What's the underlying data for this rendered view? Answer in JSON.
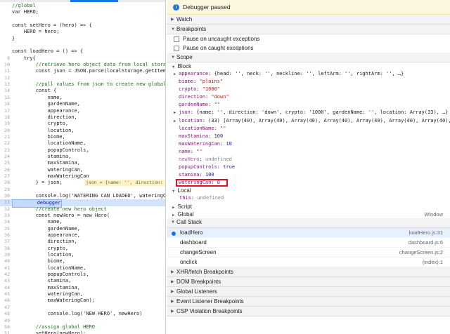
{
  "editor": {
    "lines": [
      {
        "n": "",
        "t": "//global",
        "kind": "comment"
      },
      {
        "n": "",
        "t": "var HERO;",
        "kind": "code"
      },
      {
        "n": "",
        "t": "",
        "kind": "code"
      },
      {
        "n": "",
        "t": "const setHero = (hero) => {",
        "kind": "code"
      },
      {
        "n": "",
        "t": "    HERO = hero;",
        "kind": "code"
      },
      {
        "n": "",
        "t": "}",
        "kind": "code"
      },
      {
        "n": "",
        "t": "",
        "kind": "code"
      },
      {
        "n": "",
        "t": "const loadHero = () => {",
        "kind": "code"
      },
      {
        "n": "9",
        "t": "    try{",
        "kind": "code"
      },
      {
        "n": "10",
        "t": "        //retrieve hero object data from local stora",
        "kind": "comment"
      },
      {
        "n": "11",
        "t": "        const json = JSON.parse(localStorage.getItem",
        "kind": "code"
      },
      {
        "n": "12",
        "t": "",
        "kind": "code"
      },
      {
        "n": "13",
        "t": "        //pull values from json to create new global",
        "kind": "comment"
      },
      {
        "n": "14",
        "t": "        const {",
        "kind": "code"
      },
      {
        "n": "15",
        "t": "            name,",
        "kind": "code"
      },
      {
        "n": "16",
        "t": "            gardenName,",
        "kind": "code"
      },
      {
        "n": "17",
        "t": "            appearance,",
        "kind": "code"
      },
      {
        "n": "18",
        "t": "            direction,",
        "kind": "code"
      },
      {
        "n": "19",
        "t": "            crypto,",
        "kind": "code"
      },
      {
        "n": "20",
        "t": "            location,",
        "kind": "code"
      },
      {
        "n": "21",
        "t": "            biome,",
        "kind": "code"
      },
      {
        "n": "22",
        "t": "            locationName,",
        "kind": "code"
      },
      {
        "n": "23",
        "t": "            popupControls,",
        "kind": "code"
      },
      {
        "n": "24",
        "t": "            stamina,",
        "kind": "code"
      },
      {
        "n": "25",
        "t": "            maxStamina,",
        "kind": "code"
      },
      {
        "n": "26",
        "t": "            wateringCan,",
        "kind": "code"
      },
      {
        "n": "27",
        "t": "            maxWateringCan",
        "kind": "code"
      },
      {
        "n": "28",
        "t": "        } = json;",
        "kind": "code",
        "inline": "json = {name: '', direction: 'dow"
      },
      {
        "n": "29",
        "t": "",
        "kind": "code"
      },
      {
        "n": "30",
        "t": "        console.log('WATERING CAN LOADED', wateringC",
        "kind": "code"
      },
      {
        "n": "31",
        "t": "        debugger",
        "kind": "exec"
      },
      {
        "n": "32",
        "t": "        //create new hero object",
        "kind": "comment"
      },
      {
        "n": "33",
        "t": "        const newHero = new Hero(",
        "kind": "code"
      },
      {
        "n": "34",
        "t": "            name,",
        "kind": "code"
      },
      {
        "n": "35",
        "t": "            gardenName,",
        "kind": "code"
      },
      {
        "n": "36",
        "t": "            appearance,",
        "kind": "code"
      },
      {
        "n": "37",
        "t": "            direction,",
        "kind": "code"
      },
      {
        "n": "38",
        "t": "            crypto,",
        "kind": "code"
      },
      {
        "n": "39",
        "t": "            location,",
        "kind": "code"
      },
      {
        "n": "40",
        "t": "            biome,",
        "kind": "code"
      },
      {
        "n": "41",
        "t": "            locationName,",
        "kind": "code"
      },
      {
        "n": "42",
        "t": "            popupControls,",
        "kind": "code"
      },
      {
        "n": "43",
        "t": "            stamina,",
        "kind": "code"
      },
      {
        "n": "44",
        "t": "            maxStamina,",
        "kind": "code"
      },
      {
        "n": "45",
        "t": "            wateringCan,",
        "kind": "code"
      },
      {
        "n": "46",
        "t": "            maxWateringCan);",
        "kind": "code"
      },
      {
        "n": "47",
        "t": "",
        "kind": "code"
      },
      {
        "n": "48",
        "t": "            console.log('NEW HERO', newHero)",
        "kind": "code"
      },
      {
        "n": "49",
        "t": "",
        "kind": "code"
      },
      {
        "n": "50",
        "t": "        //assign global HERO",
        "kind": "comment"
      },
      {
        "n": "51",
        "t": "        setHero(newHero);",
        "kind": "code"
      },
      {
        "n": "52",
        "t": "        console.log('Hero Loaded:', newHero)",
        "kind": "code"
      }
    ]
  },
  "debugger": {
    "banner": "Debugger paused",
    "sections": {
      "watch": "Watch",
      "breakpoints": "Breakpoints",
      "scope": "Scope",
      "callstack": "Call Stack",
      "xhr": "XHR/fetch Breakpoints",
      "dom": "DOM Breakpoints",
      "global_listeners": "Global Listeners",
      "event_listener": "Event Listener Breakpoints",
      "csp": "CSP Violation Breakpoints"
    },
    "breakpoint_options": [
      "Pause on uncaught exceptions",
      "Pause on caught exceptions"
    ],
    "scope_block_label": "Block",
    "scope_entries": [
      {
        "k": "appearance",
        "v": "{head: '', neck: '', neckline: '', leftArm: '', rightArm: '', …}",
        "type": "obj",
        "expand": true
      },
      {
        "k": "biome",
        "v": "\"plains\"",
        "type": "str"
      },
      {
        "k": "crypto",
        "v": "\"1000\"",
        "type": "str"
      },
      {
        "k": "direction",
        "v": "\"down\"",
        "type": "str"
      },
      {
        "k": "gardenName",
        "v": "\"\"",
        "type": "str"
      },
      {
        "k": "json",
        "v": "{name: '', direction: 'down', crypto: '1000', gardenName: '', location: Array(33), …}",
        "type": "obj",
        "expand": true
      },
      {
        "k": "location",
        "v": "(33) [Array(40), Array(40), Array(40), Array(40), Array(40), Array(40), Array(40),",
        "type": "obj",
        "expand": true
      },
      {
        "k": "locationName",
        "v": "\"\"",
        "type": "str"
      },
      {
        "k": "maxStamina",
        "v": "100",
        "type": "num"
      },
      {
        "k": "maxWateringCan",
        "v": "10",
        "type": "num"
      },
      {
        "k": "name",
        "v": "\"\"",
        "type": "str"
      },
      {
        "k": "newHero",
        "v": "undefined",
        "type": "undef",
        "dim": true
      },
      {
        "k": "popupControls",
        "v": "true",
        "type": "kw"
      },
      {
        "k": "stamina",
        "v": "100",
        "type": "num"
      },
      {
        "k": "wateringCan",
        "v": "0",
        "type": "num",
        "highlight": true
      }
    ],
    "scope_local_label": "Local",
    "scope_local_this": {
      "k": "this",
      "v": "undefined"
    },
    "scope_script_label": "Script",
    "scope_global_label": "Global",
    "scope_global_value": "Window",
    "call_stack": [
      {
        "fn": "loadHero",
        "loc": "loadHero.js:31",
        "active": true
      },
      {
        "fn": "dashboard",
        "loc": "dashboard.js:6"
      },
      {
        "fn": "changeScreen",
        "loc": "changeScreen.js:2"
      },
      {
        "fn": "onclick",
        "loc": "(index):1"
      }
    ]
  }
}
